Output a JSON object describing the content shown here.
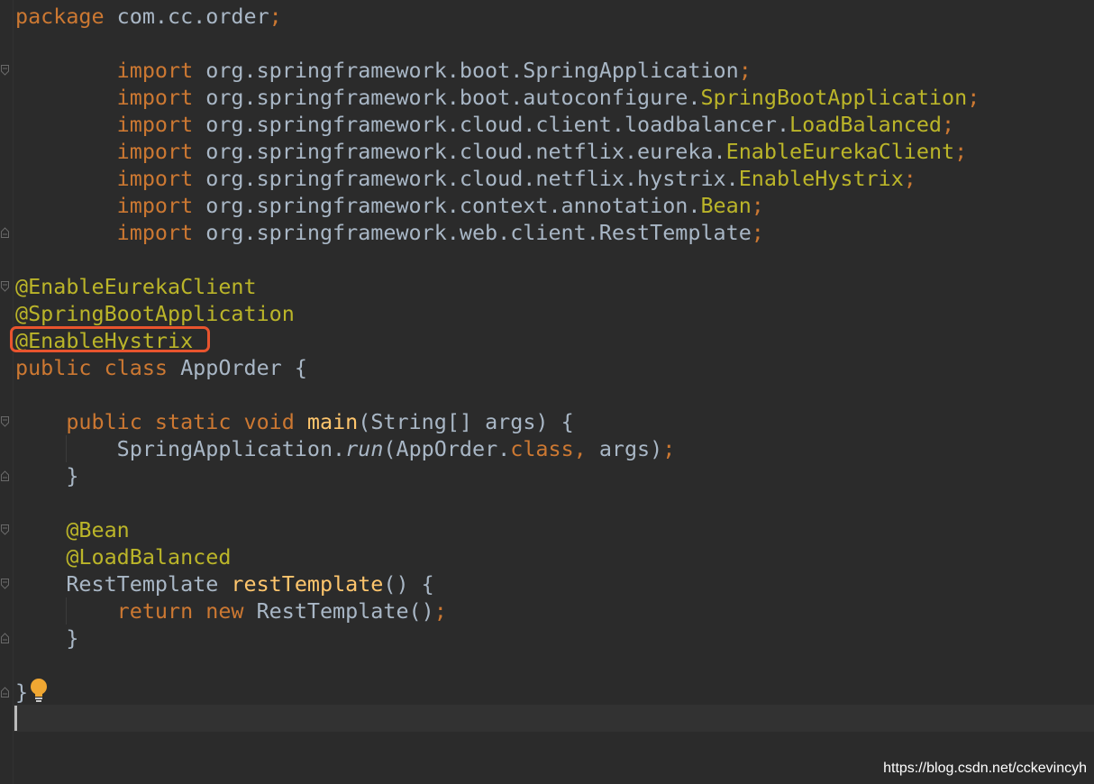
{
  "editor": {
    "theme_colors": {
      "background": "#2b2b2b",
      "keyword": "#cc7832",
      "annotation": "#bbb529",
      "method": "#ffc66d",
      "plain": "#a9b7c6",
      "highlight_box": "#e8542e"
    },
    "lines": [
      [
        {
          "t": "package",
          "c": "kw"
        },
        {
          "t": " com.cc.order",
          "c": "pl"
        },
        {
          "t": ";",
          "c": "kw"
        }
      ],
      [],
      [
        {
          "t": "        import",
          "c": "kw"
        },
        {
          "t": " org.springframework.boot.SpringApplication",
          "c": "pl"
        },
        {
          "t": ";",
          "c": "kw"
        }
      ],
      [
        {
          "t": "        import",
          "c": "kw"
        },
        {
          "t": " org.springframework.boot.autoconfigure.",
          "c": "pl"
        },
        {
          "t": "SpringBootApplication",
          "c": "ann"
        },
        {
          "t": ";",
          "c": "kw"
        }
      ],
      [
        {
          "t": "        import",
          "c": "kw"
        },
        {
          "t": " org.springframework.cloud.client.loadbalancer.",
          "c": "pl"
        },
        {
          "t": "LoadBalanced",
          "c": "ann"
        },
        {
          "t": ";",
          "c": "kw"
        }
      ],
      [
        {
          "t": "        import",
          "c": "kw"
        },
        {
          "t": " org.springframework.cloud.netflix.eureka.",
          "c": "pl"
        },
        {
          "t": "EnableEurekaClient",
          "c": "ann"
        },
        {
          "t": ";",
          "c": "kw"
        }
      ],
      [
        {
          "t": "        import",
          "c": "kw"
        },
        {
          "t": " org.springframework.cloud.netflix.hystrix.",
          "c": "pl"
        },
        {
          "t": "EnableHystrix",
          "c": "ann"
        },
        {
          "t": ";",
          "c": "kw"
        }
      ],
      [
        {
          "t": "        import",
          "c": "kw"
        },
        {
          "t": " org.springframework.context.annotation.",
          "c": "pl"
        },
        {
          "t": "Bean",
          "c": "ann"
        },
        {
          "t": ";",
          "c": "kw"
        }
      ],
      [
        {
          "t": "        import",
          "c": "kw"
        },
        {
          "t": " org.springframework.web.client.RestTemplate",
          "c": "pl"
        },
        {
          "t": ";",
          "c": "kw"
        }
      ],
      [],
      [
        {
          "t": "@EnableEurekaClient",
          "c": "ann"
        }
      ],
      [
        {
          "t": "@SpringBootApplication",
          "c": "ann"
        }
      ],
      [
        {
          "t": "@EnableHystrix",
          "c": "ann"
        }
      ],
      [
        {
          "t": "public class",
          "c": "kw"
        },
        {
          "t": " AppOrder {",
          "c": "pl"
        }
      ],
      [],
      [
        {
          "t": "    public static void",
          "c": "kw"
        },
        {
          "t": " ",
          "c": "pl"
        },
        {
          "t": "main",
          "c": "fn"
        },
        {
          "t": "(String[] args) {",
          "c": "pl"
        }
      ],
      [
        {
          "t": "        SpringApplication.",
          "c": "pl"
        },
        {
          "t": "run",
          "c": "it"
        },
        {
          "t": "(AppOrder.",
          "c": "pl"
        },
        {
          "t": "class, ",
          "c": "kw"
        },
        {
          "t": "args)",
          "c": "pl"
        },
        {
          "t": ";",
          "c": "kw"
        }
      ],
      [
        {
          "t": "    }",
          "c": "pl"
        }
      ],
      [],
      [
        {
          "t": "    @Bean",
          "c": "ann"
        }
      ],
      [
        {
          "t": "    @LoadBalanced",
          "c": "ann"
        }
      ],
      [
        {
          "t": "    RestTemplate ",
          "c": "pl"
        },
        {
          "t": "restTemplate",
          "c": "fn"
        },
        {
          "t": "() {",
          "c": "pl"
        }
      ],
      [
        {
          "t": "        return new",
          "c": "kw"
        },
        {
          "t": " RestTemplate()",
          "c": "pl"
        },
        {
          "t": ";",
          "c": "kw"
        }
      ],
      [
        {
          "t": "    }",
          "c": "pl"
        }
      ],
      [],
      [
        {
          "t": "}",
          "c": "pl"
        }
      ]
    ],
    "fold_markers": [
      {
        "line": 2,
        "kind": "open"
      },
      {
        "line": 8,
        "kind": "close"
      },
      {
        "line": 10,
        "kind": "open"
      },
      {
        "line": 15,
        "kind": "open"
      },
      {
        "line": 17,
        "kind": "close"
      },
      {
        "line": 19,
        "kind": "open"
      },
      {
        "line": 21,
        "kind": "open"
      },
      {
        "line": 23,
        "kind": "close"
      },
      {
        "line": 25,
        "kind": "close"
      }
    ],
    "intention_icon": "lightbulb-icon"
  },
  "watermark": {
    "text": "https://blog.csdn.net/cckevincyh"
  }
}
